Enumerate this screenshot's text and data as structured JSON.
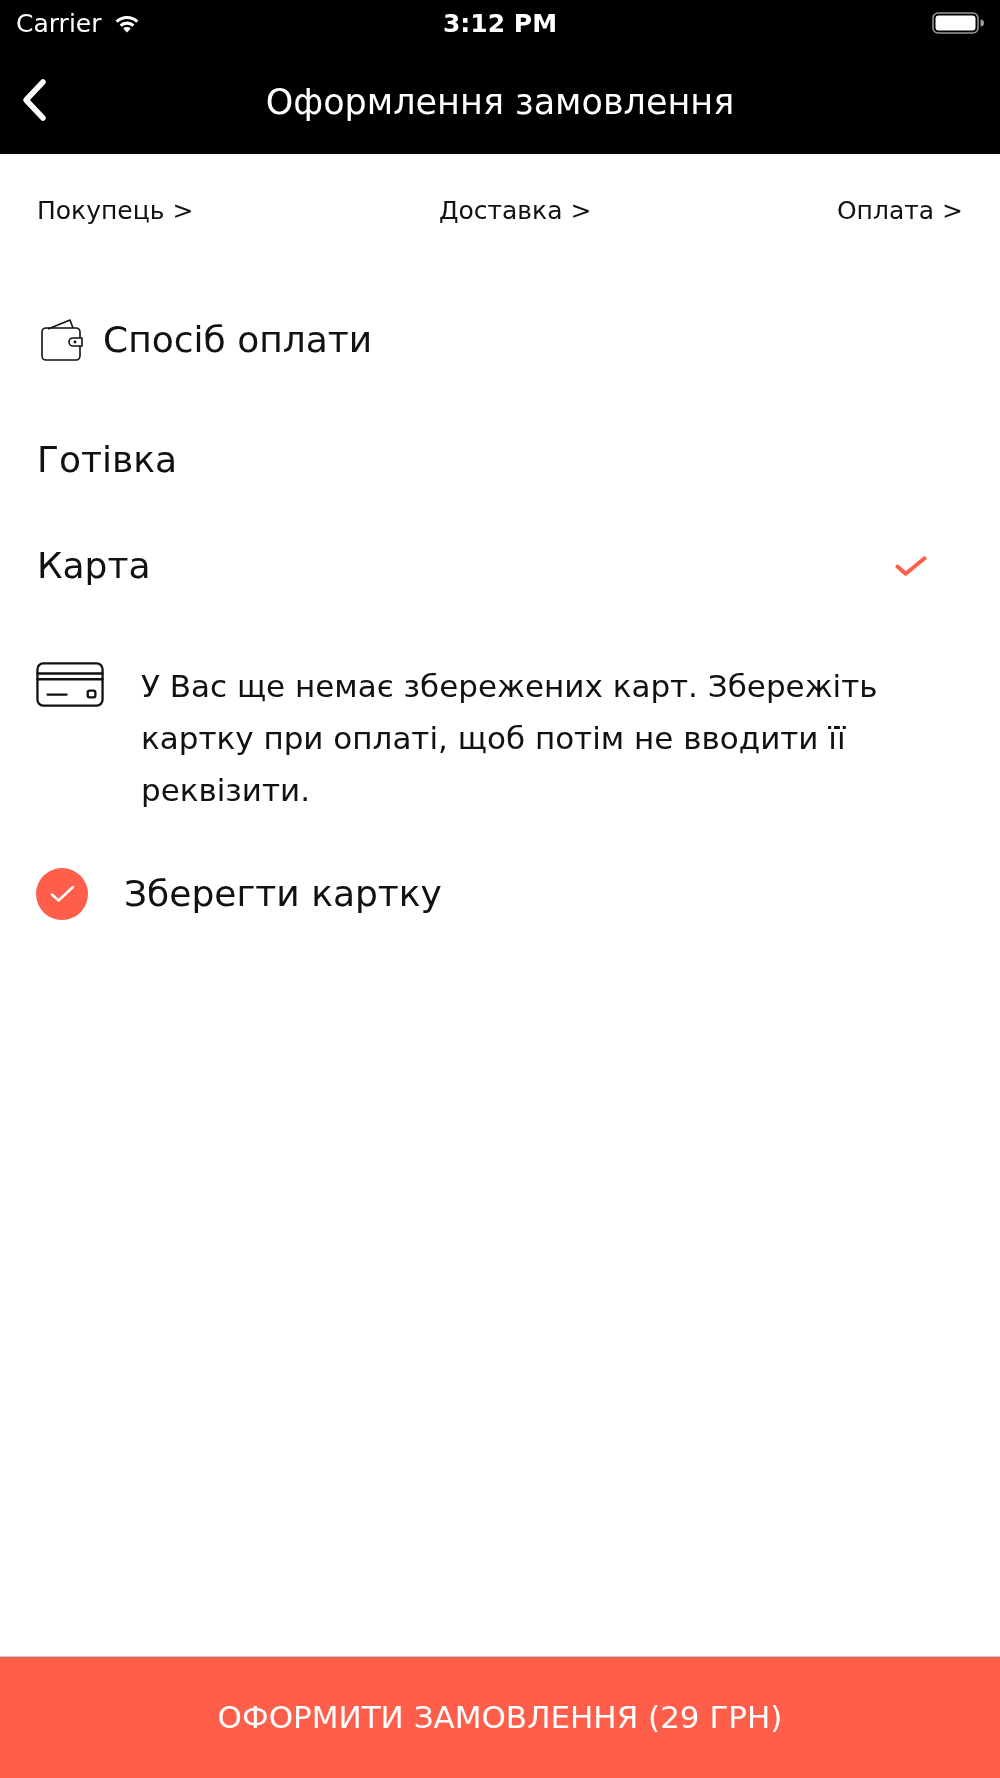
{
  "status_bar": {
    "carrier": "Carrier",
    "time": "3:12 PM"
  },
  "nav_bar": {
    "title": "Оформлення замовлення"
  },
  "steps": [
    {
      "label": "Покупець >"
    },
    {
      "label": "Доставка >"
    },
    {
      "label": "Оплата >"
    }
  ],
  "payment_section": {
    "title": "Спосіб оплати",
    "options": [
      {
        "label": "Готівка",
        "selected": false
      },
      {
        "label": "Карта",
        "selected": true
      }
    ]
  },
  "saved_cards": {
    "message": "У Вас ще немає збережених карт. Збережіть картку при оплаті, щоб потім не вводити її реквізити."
  },
  "save_card": {
    "label": "Зберегти картку",
    "checked": true
  },
  "submit_button": {
    "label": "ОФОРМИТИ ЗАМОВЛЕННЯ (29 ГРН)"
  }
}
